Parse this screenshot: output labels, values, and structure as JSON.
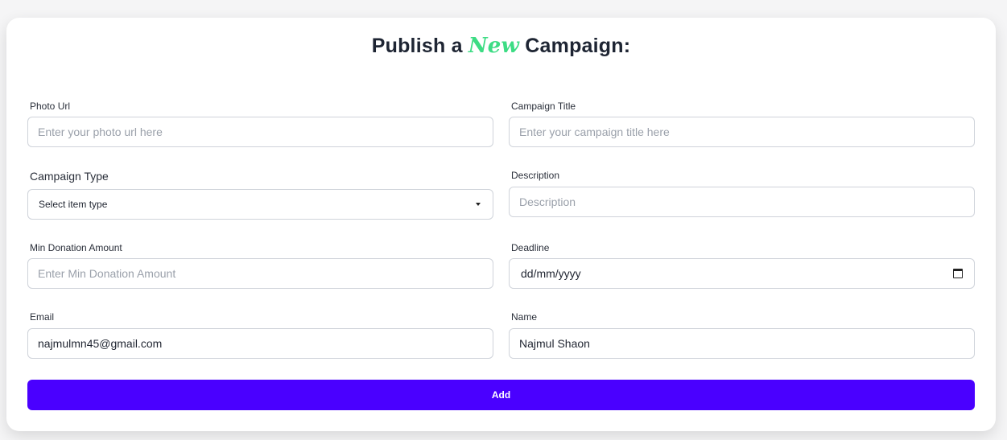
{
  "form": {
    "title_prefix": "Publish a",
    "title_accent": "New",
    "title_suffix": "Campaign:",
    "accent_color": "#3ddc84",
    "photo_url": {
      "label": "Photo Url",
      "placeholder": "Enter your photo url here",
      "value": ""
    },
    "campaign_title": {
      "label": "Campaign Title",
      "placeholder": "Enter your campaign title here",
      "value": ""
    },
    "campaign_type": {
      "label": "Campaign Type",
      "selected": "Select item type"
    },
    "description": {
      "label": "Description",
      "placeholder": "Description",
      "value": ""
    },
    "min_donation": {
      "label": "Min Donation Amount",
      "placeholder": "Enter Min Donation Amount",
      "value": ""
    },
    "deadline": {
      "label": "Deadline",
      "display": "dd/mm/yyyy",
      "icon": "calendar-icon"
    },
    "email": {
      "label": "Email",
      "value": "najmulmn45@gmail.com"
    },
    "name": {
      "label": "Name",
      "value": "Najmul Shaon"
    },
    "submit_label": "Add",
    "submit_color": "#4a00ff"
  }
}
